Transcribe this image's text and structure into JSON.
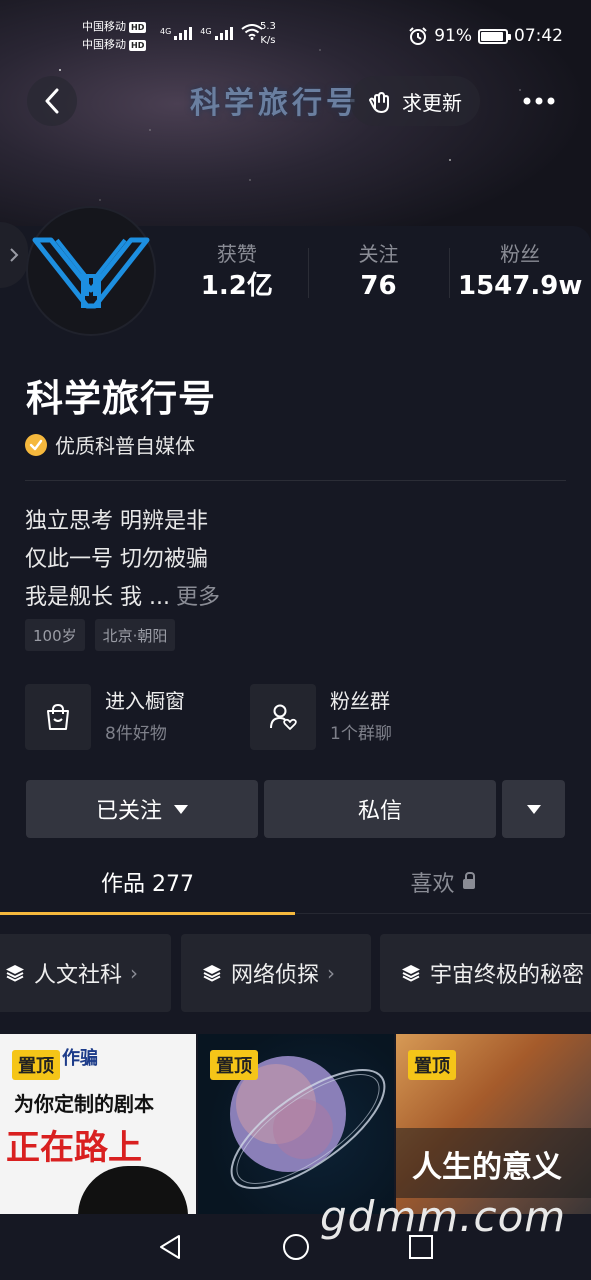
{
  "status_bar": {
    "carrier1": "中国移动",
    "carrier2": "中国移动",
    "hd": "HD",
    "net_type1": "4G",
    "net_type2": "4G",
    "speed_value": "5.3",
    "speed_unit": "K/s",
    "battery": "91%",
    "battery_level": 0.91,
    "time": "07:42"
  },
  "header": {
    "banner_text": "科学旅行号",
    "update_label": "求更新"
  },
  "stats": [
    {
      "label": "获赞",
      "value": "1.2亿"
    },
    {
      "label": "关注",
      "value": "76"
    },
    {
      "label": "粉丝",
      "value": "1547.9w"
    }
  ],
  "profile": {
    "name": "科学旅行号",
    "verify_text": "优质科普自媒体",
    "bio_lines": [
      "独立思考 明辨是非",
      "仅此一号 切勿被骗",
      "我是舰长 我 ..."
    ],
    "bio_more": "更多",
    "tags": [
      "100岁",
      "北京·朝阳"
    ]
  },
  "features": [
    {
      "title": "进入橱窗",
      "sub": "8件好物"
    },
    {
      "title": "粉丝群",
      "sub": "1个群聊"
    }
  ],
  "actions": {
    "followed": "已关注",
    "message": "私信"
  },
  "tabs": {
    "works": "作品 277",
    "likes": "喜欢"
  },
  "collections": [
    "人文社科",
    "网络侦探",
    "宇宙终极的秘密"
  ],
  "videos": {
    "pin_label": "置顶",
    "v1_line1": "为你定制的剧本",
    "v1_line2": "正在路上",
    "v1_top": "作骗",
    "v3_caption": "人生的意义"
  },
  "watermark": "gdmm.com",
  "colors": {
    "accent": "#f5b83d",
    "background": "#161823",
    "button": "#33353f"
  }
}
